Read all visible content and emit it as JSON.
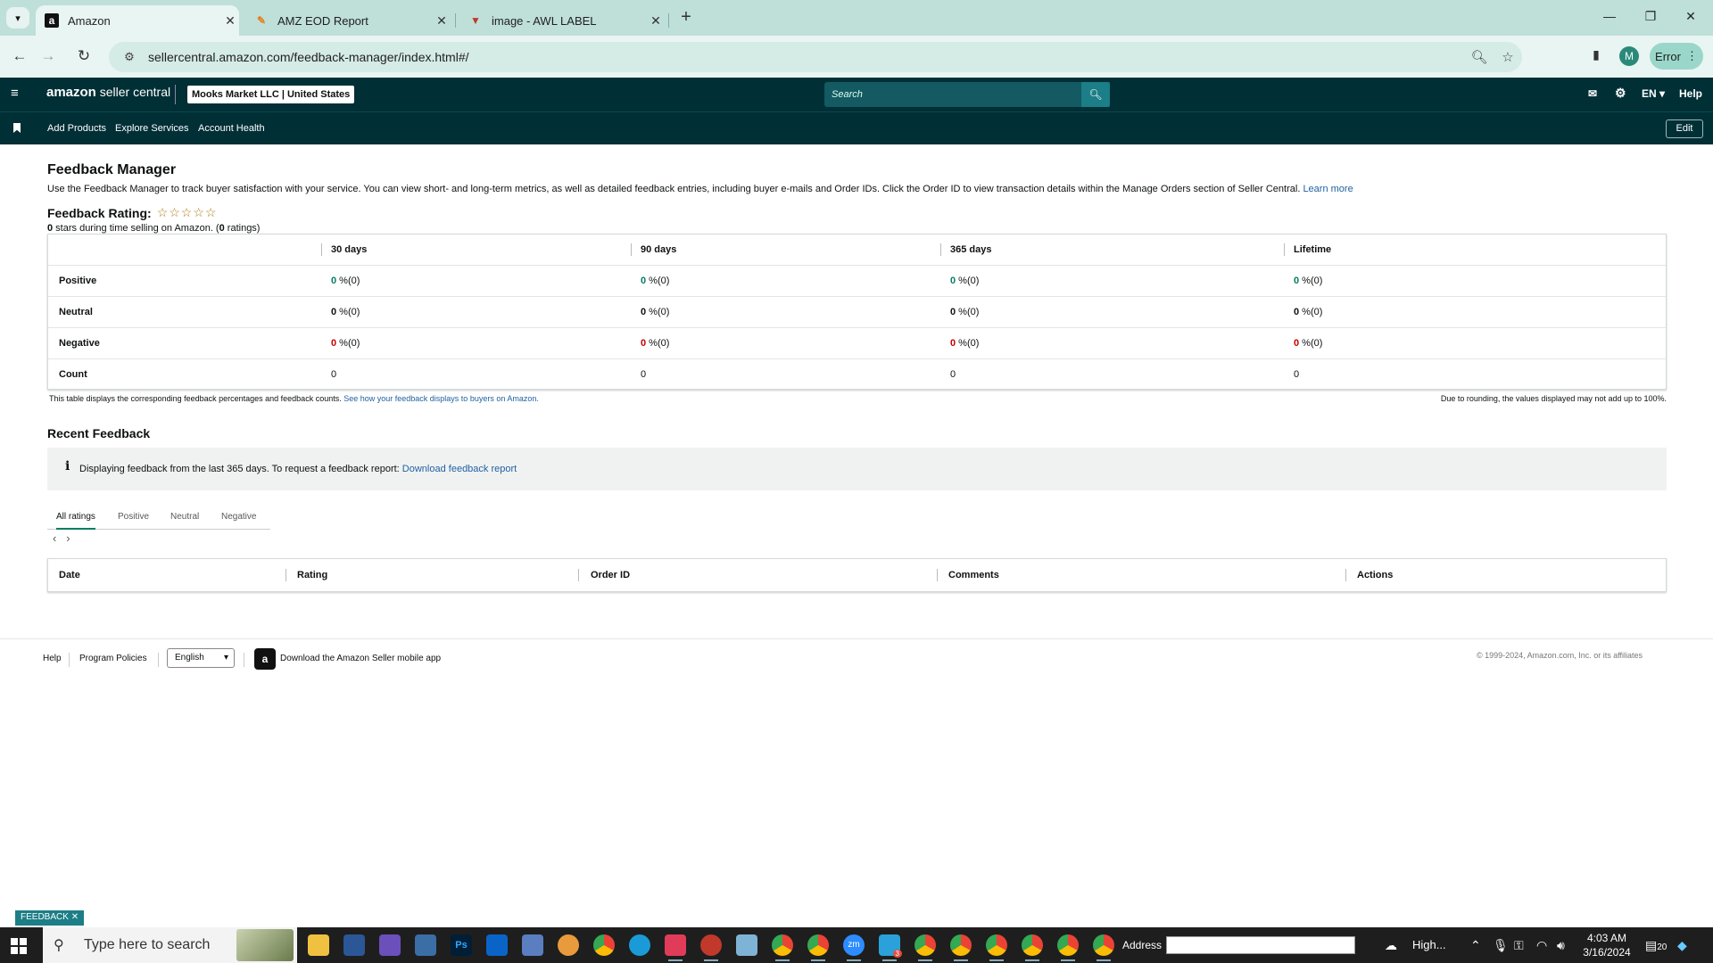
{
  "browser": {
    "tabs": [
      {
        "title": "Amazon",
        "favicon": "amazon-favicon",
        "active": true
      },
      {
        "title": "AMZ EOD Report",
        "favicon": "report-favicon",
        "active": false
      },
      {
        "title": "image - AWL LABEL",
        "favicon": "label-favicon",
        "active": false
      }
    ],
    "url": "sellercentral.amazon.com/feedback-manager/index.html#/",
    "profile_initial": "M",
    "error_label": "Error"
  },
  "header": {
    "brand_main": "amazon",
    "brand_sub": "seller central",
    "account": "Mooks Market LLC | United States",
    "search_placeholder": "Search",
    "language": "EN",
    "help": "Help"
  },
  "nav": {
    "links": [
      "Add Products",
      "Explore Services",
      "Account Health"
    ],
    "edit": "Edit"
  },
  "page": {
    "title": "Feedback Manager",
    "description": "Use the Feedback Manager to track buyer satisfaction with your service. You can view short- and long-term metrics, as well as detailed feedback entries, including buyer e-mails and Order IDs. Click the Order ID to view transaction details within the Manage Orders section of Seller Central.",
    "learn_more": "Learn more",
    "rating_label": "Feedback Rating:",
    "stars": 0,
    "rating_sub_bold": "0",
    "rating_sub_text": " stars during time selling on Amazon. (",
    "rating_count": "0",
    "rating_count_suffix": " ratings)"
  },
  "feedback_table": {
    "columns": [
      "30 days",
      "90 days",
      "365 days",
      "Lifetime"
    ],
    "rows": [
      {
        "label": "Positive",
        "values": [
          "0",
          "0",
          "0",
          "0"
        ],
        "suffix": " %(0)"
      },
      {
        "label": "Neutral",
        "values": [
          "0",
          "0",
          "0",
          "0"
        ],
        "suffix": " %(0)"
      },
      {
        "label": "Negative",
        "values": [
          "0",
          "0",
          "0",
          "0"
        ],
        "suffix": " %(0)"
      },
      {
        "label": "Count",
        "values": [
          "0",
          "0",
          "0",
          "0"
        ],
        "suffix": ""
      }
    ],
    "note": "This table displays the corresponding feedback percentages and feedback counts.",
    "note_link": "See how your feedback displays to buyers on Amazon.",
    "rounding_note": "Due to rounding, the values displayed may not add up to 100%."
  },
  "recent": {
    "title": "Recent Feedback",
    "info_text": "Displaying feedback from the last 365 days. To request a feedback report:",
    "info_link": "Download feedback report",
    "tabs": [
      "All ratings",
      "Positive",
      "Neutral",
      "Negative"
    ],
    "columns": [
      "Date",
      "Rating",
      "Order ID",
      "Comments",
      "Actions"
    ]
  },
  "footer": {
    "help": "Help",
    "policies": "Program Policies",
    "language": "English",
    "app": "Download the Amazon Seller mobile app",
    "copyright": "© 1999-2024, Amazon.com, Inc. or its affiliates",
    "feedback_tab": "FEEDBACK"
  },
  "taskbar": {
    "search_placeholder": "Type here to search",
    "address_label": "Address",
    "weather": "High...",
    "time": "4:03 AM",
    "date": "3/16/2024",
    "notifications": "20",
    "badge": "3"
  }
}
